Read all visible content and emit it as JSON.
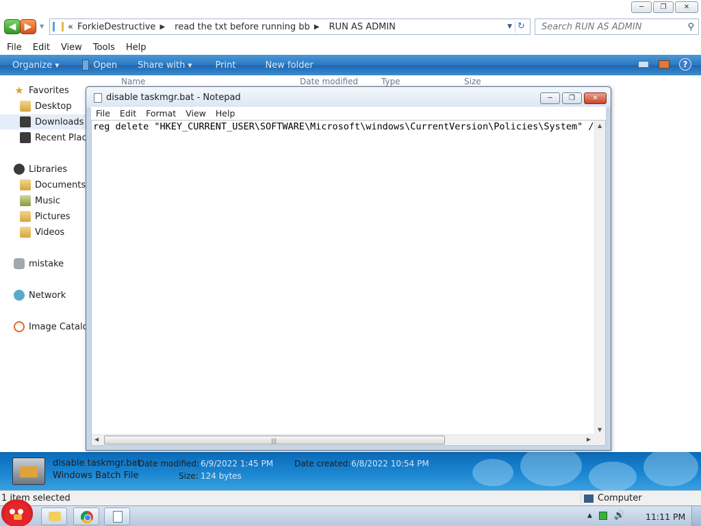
{
  "explorer": {
    "window_buttons": [
      "minimize",
      "maximize",
      "close"
    ],
    "breadcrumb": [
      "ForkieDestructive",
      "read the txt before running bb",
      "RUN AS ADMIN"
    ],
    "breadcrumb_prefix": "«",
    "search": {
      "placeholder": "Search RUN AS ADMIN"
    },
    "menu": [
      "File",
      "Edit",
      "View",
      "Tools",
      "Help"
    ],
    "commands": {
      "organize": "Organize",
      "open": "Open",
      "share_with": "Share with",
      "print": "Print",
      "new_folder": "New folder"
    },
    "columns": [
      "Name",
      "Date modified",
      "Type",
      "Size"
    ],
    "nav": {
      "favorites": "Favorites",
      "desktop": "Desktop",
      "downloads": "Downloads",
      "recent_places": "Recent Places",
      "libraries": "Libraries",
      "documents": "Documents",
      "music": "Music",
      "pictures": "Pictures",
      "videos": "Videos",
      "user": "mistake",
      "network": "Network",
      "image_catalog": "Image Catalog"
    },
    "details": {
      "file_name": "disable taskmgr.bat",
      "file_type": "Windows Batch File",
      "date_modified_label": "Date modified:",
      "date_modified": "6/9/2022 1:45 PM",
      "size_label": "Size:",
      "size": "124 bytes",
      "date_created_label": "Date created:",
      "date_created": "6/8/2022 10:54 PM"
    },
    "status": {
      "selection": "1 item selected",
      "zone": "Computer"
    }
  },
  "notepad": {
    "title": "disable taskmgr.bat - Notepad",
    "menu": [
      "File",
      "Edit",
      "Format",
      "View",
      "Help"
    ],
    "content": "reg delete \"HKEY_CURRENT_USER\\SOFTWARE\\Microsoft\\windows\\CurrentVersion\\Policies\\System\" /v"
  },
  "taskbar": {
    "clock": "11:11 PM",
    "pinned": [
      "explorer-icon",
      "chrome-icon",
      "notepad-icon"
    ]
  }
}
